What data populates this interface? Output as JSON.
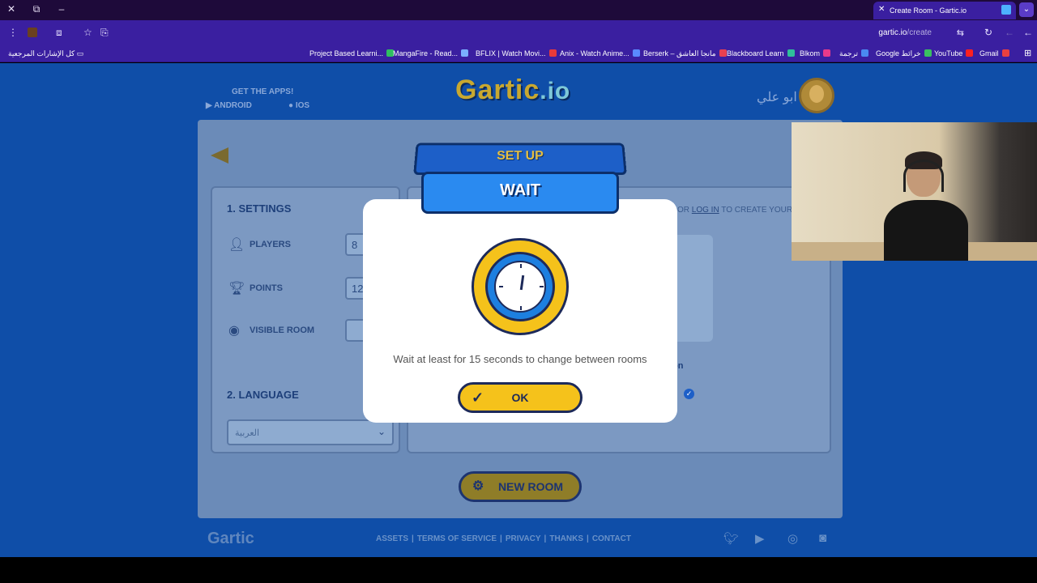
{
  "browser": {
    "tab_title": "Create Room - Gartic.io",
    "url_host": "gartic.io",
    "url_path": "/create",
    "bookmarks_all": "كل الإشارات المرجعية",
    "bookmarks": [
      "Project Based Learni...",
      "MangaFire - Read...",
      "BFLIX | Watch Movi...",
      "Anix - Watch Anime...",
      "Berserk – مانجا العاشق",
      "Blackboard Learn",
      "Blkom",
      "ترجمة",
      "Google خرائط",
      "YouTube",
      "Gmail"
    ]
  },
  "header": {
    "get_apps": "GET THE APPS!",
    "android": "ANDROID",
    "ios": "IOS",
    "logo_main": "Gartic",
    "logo_suffix": ".io",
    "username": "ابو علي"
  },
  "settings": {
    "title": "1. SETTINGS",
    "players_label": "PLAYERS",
    "players_value": "8",
    "points_label": "POINTS",
    "points_value": "12",
    "visible_label": "VISIBLE ROOM",
    "language_title": "2. LANGUAGE",
    "language_value": "العربية"
  },
  "main": {
    "login_prefix": "OR ",
    "login_link": "LOG IN",
    "login_suffix": " TO CREATE YOUR",
    "mode_label": "on",
    "new_room": "NEW ROOM"
  },
  "modal": {
    "banner_top": "SET UP",
    "banner_main": "WAIT",
    "message": "Wait at least for 15 seconds to change between rooms",
    "ok_label": "OK"
  },
  "footer": {
    "logo": "Gartic",
    "links": [
      "ASSETS",
      "TERMS OF SERVICE",
      "PRIVACY",
      "THANKS",
      "CONTACT"
    ],
    "social_icons": [
      "twitter-icon",
      "youtube-icon",
      "instagram-icon",
      "discord-icon"
    ]
  },
  "colors": {
    "page_bg": "#0f4ea8",
    "accent_yellow": "#f5c21b",
    "accent_blue": "#1d7fe0"
  }
}
